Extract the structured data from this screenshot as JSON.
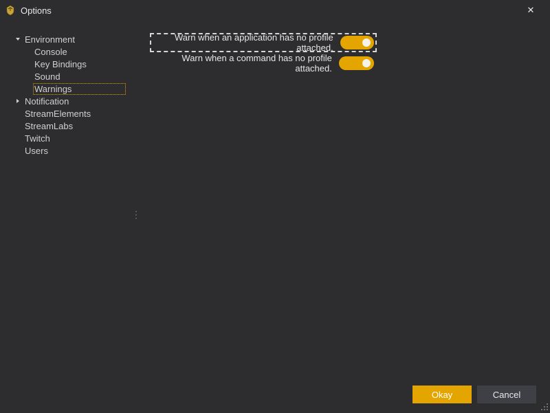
{
  "window": {
    "title": "Options",
    "close_glyph": "✕",
    "app_icon_name": "app-icon"
  },
  "sidebar": {
    "items": [
      {
        "label": "Environment",
        "expandable": true,
        "expanded": true
      },
      {
        "label": "Console",
        "child": true
      },
      {
        "label": "Key Bindings",
        "child": true
      },
      {
        "label": "Sound",
        "child": true
      },
      {
        "label": "Warnings",
        "child": true,
        "selected": true
      },
      {
        "label": "Notification",
        "expandable": true,
        "expanded": false
      },
      {
        "label": "StreamElements"
      },
      {
        "label": "StreamLabs"
      },
      {
        "label": "Twitch"
      },
      {
        "label": "Users"
      }
    ]
  },
  "content": {
    "options": [
      {
        "label": "Warn when an application has no profile attached.",
        "value": true,
        "focused": true
      },
      {
        "label": "Warn when a command has no profile attached.",
        "value": true,
        "focused": false
      }
    ]
  },
  "footer": {
    "okay_label": "Okay",
    "cancel_label": "Cancel"
  },
  "colors": {
    "accent": "#e5a500",
    "bg": "#2d2d30",
    "text": "#d0d0d0"
  }
}
